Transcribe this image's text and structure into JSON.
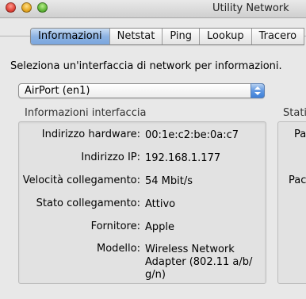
{
  "window": {
    "title": "Utility Network"
  },
  "tabs": [
    {
      "label": "Informazioni",
      "active": true
    },
    {
      "label": "Netstat",
      "active": false
    },
    {
      "label": "Ping",
      "active": false
    },
    {
      "label": "Lookup",
      "active": false
    },
    {
      "label": "Tracero",
      "active": false
    }
  ],
  "prompt": "Seleziona un'interfaccia di network per informazioni.",
  "interface_select": {
    "selected": "AirPort (en1)"
  },
  "interface_info": {
    "title": "Informazioni interfaccia",
    "rows": [
      {
        "label": "Indirizzo hardware:",
        "value": "00:1e:c2:be:0a:c7"
      },
      {
        "label": "Indirizzo IP:",
        "value": "192.168.1.177"
      },
      {
        "label": "Velocità collegamento:",
        "value": "54 Mbit/s"
      },
      {
        "label": "Stato collegamento:",
        "value": "Attivo"
      },
      {
        "label": "Fornitore:",
        "value": "Apple"
      },
      {
        "label": "Modello:",
        "value": "Wireless Network Adapter (802.11 a/b/ g/n)"
      }
    ]
  },
  "stats_panel": {
    "title": "Stati",
    "labels": [
      "Pa",
      "Pac"
    ]
  },
  "colors": {
    "tab_active": "#8db3e2",
    "popup_arrow": "#5f97e1",
    "window_bg": "#e8e8e8",
    "group_bg": "#e2e2e2"
  }
}
